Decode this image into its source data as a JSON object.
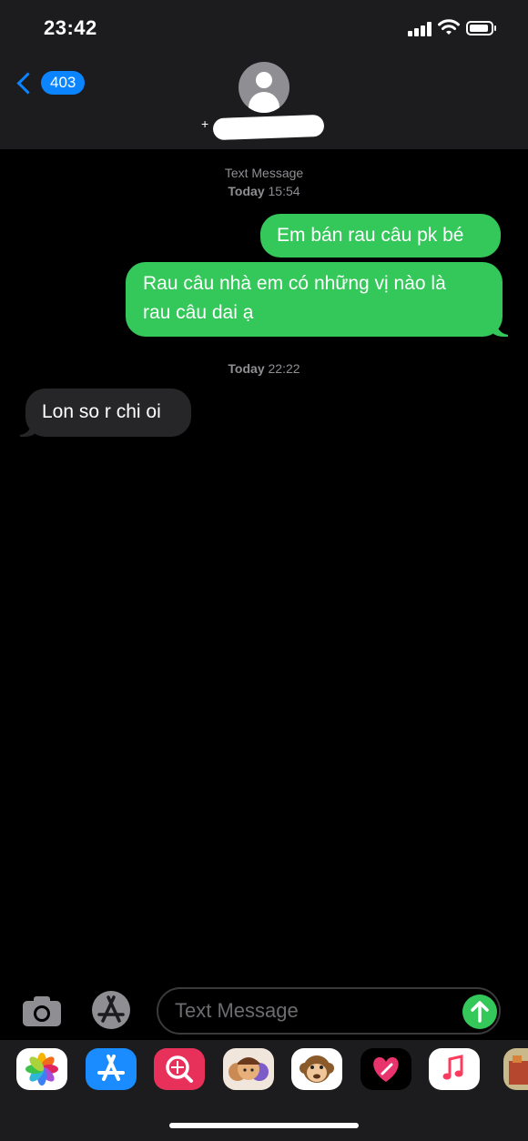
{
  "status_bar": {
    "time": "23:42",
    "icons": [
      "cellular-signal-icon",
      "wifi-icon",
      "battery-icon"
    ]
  },
  "header": {
    "back_count": "403",
    "contact_prefix": "+"
  },
  "conversation": {
    "service_label": "Text Message",
    "first_timestamp_day": "Today",
    "first_timestamp_time": "15:54",
    "second_timestamp_day": "Today",
    "second_timestamp_time": "22:22",
    "messages": [
      {
        "direction": "sent",
        "text": "Em bán rau câu pk bé"
      },
      {
        "direction": "sent",
        "lines": [
          "Rau câu nhà em có những vị nào là",
          "rau câu dai ạ"
        ]
      },
      {
        "direction": "received",
        "text": "Lon so r chi oi"
      }
    ]
  },
  "composer": {
    "placeholder": "Text Message"
  },
  "app_drawer": {
    "apps": [
      "photos-app-icon",
      "app-store-icon",
      "images-search-app-icon",
      "memoji-app-icon",
      "animoji-app-icon",
      "digital-touch-app-icon",
      "music-app-icon",
      "partial-app-icon"
    ]
  },
  "colors": {
    "sent_bubble": "#34c759",
    "received_bubble": "#262628",
    "accent_blue": "#0a84ff",
    "background": "#000000",
    "header_bg": "#1c1c1e"
  }
}
